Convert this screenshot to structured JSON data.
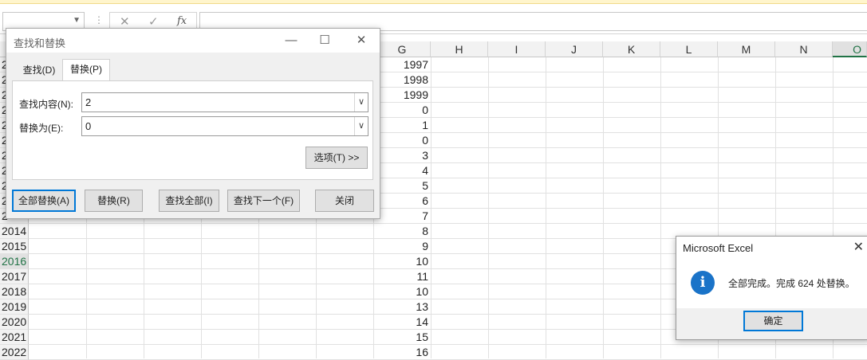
{
  "formula_bar": {
    "fx_label": "fx",
    "cancel_icon": "✕",
    "enter_icon": "✓",
    "name_value": "",
    "formula_value": ""
  },
  "columns": [
    {
      "label": "G",
      "selected": false
    },
    {
      "label": "H",
      "selected": false
    },
    {
      "label": "I",
      "selected": false
    },
    {
      "label": "J",
      "selected": false
    },
    {
      "label": "K",
      "selected": false
    },
    {
      "label": "L",
      "selected": false
    },
    {
      "label": "M",
      "selected": false
    },
    {
      "label": "N",
      "selected": false
    },
    {
      "label": "O",
      "selected": true
    }
  ],
  "rows": [
    {
      "header": "2",
      "g": "1997"
    },
    {
      "header": "2",
      "g": "1998"
    },
    {
      "header": "2",
      "g": "1999"
    },
    {
      "header": "2",
      "g": "0"
    },
    {
      "header": "2",
      "g": "1"
    },
    {
      "header": "2",
      "g": "0"
    },
    {
      "header": "2",
      "g": "3"
    },
    {
      "header": "2",
      "g": "4"
    },
    {
      "header": "2",
      "g": "5"
    },
    {
      "header": "2",
      "g": "6"
    },
    {
      "header": "2",
      "g": "7"
    },
    {
      "header": "2014",
      "g": "8"
    },
    {
      "header": "2015",
      "g": "9"
    },
    {
      "header": "2016",
      "g": "10",
      "selected": true
    },
    {
      "header": "2017",
      "g": "11"
    },
    {
      "header": "2018",
      "g": "10"
    },
    {
      "header": "2019",
      "g": "13"
    },
    {
      "header": "2020",
      "g": "14"
    },
    {
      "header": "2021",
      "g": "15"
    },
    {
      "header": "2022",
      "g": "16"
    }
  ],
  "find_replace": {
    "title": "查找和替换",
    "tabs": {
      "find": "查找(D)",
      "replace": "替换(P)"
    },
    "find_label": "查找内容(N):",
    "find_value": "2",
    "replace_label": "替换为(E):",
    "replace_value": "0",
    "options_button": "选项(T) >>",
    "buttons": {
      "replace_all": "全部替换(A)",
      "replace": "替换(R)",
      "find_all": "查找全部(I)",
      "find_next": "查找下一个(F)",
      "close": "关闭"
    }
  },
  "message_box": {
    "title": "Microsoft Excel",
    "text": "全部完成。完成 624 处替换。",
    "ok": "确定"
  }
}
